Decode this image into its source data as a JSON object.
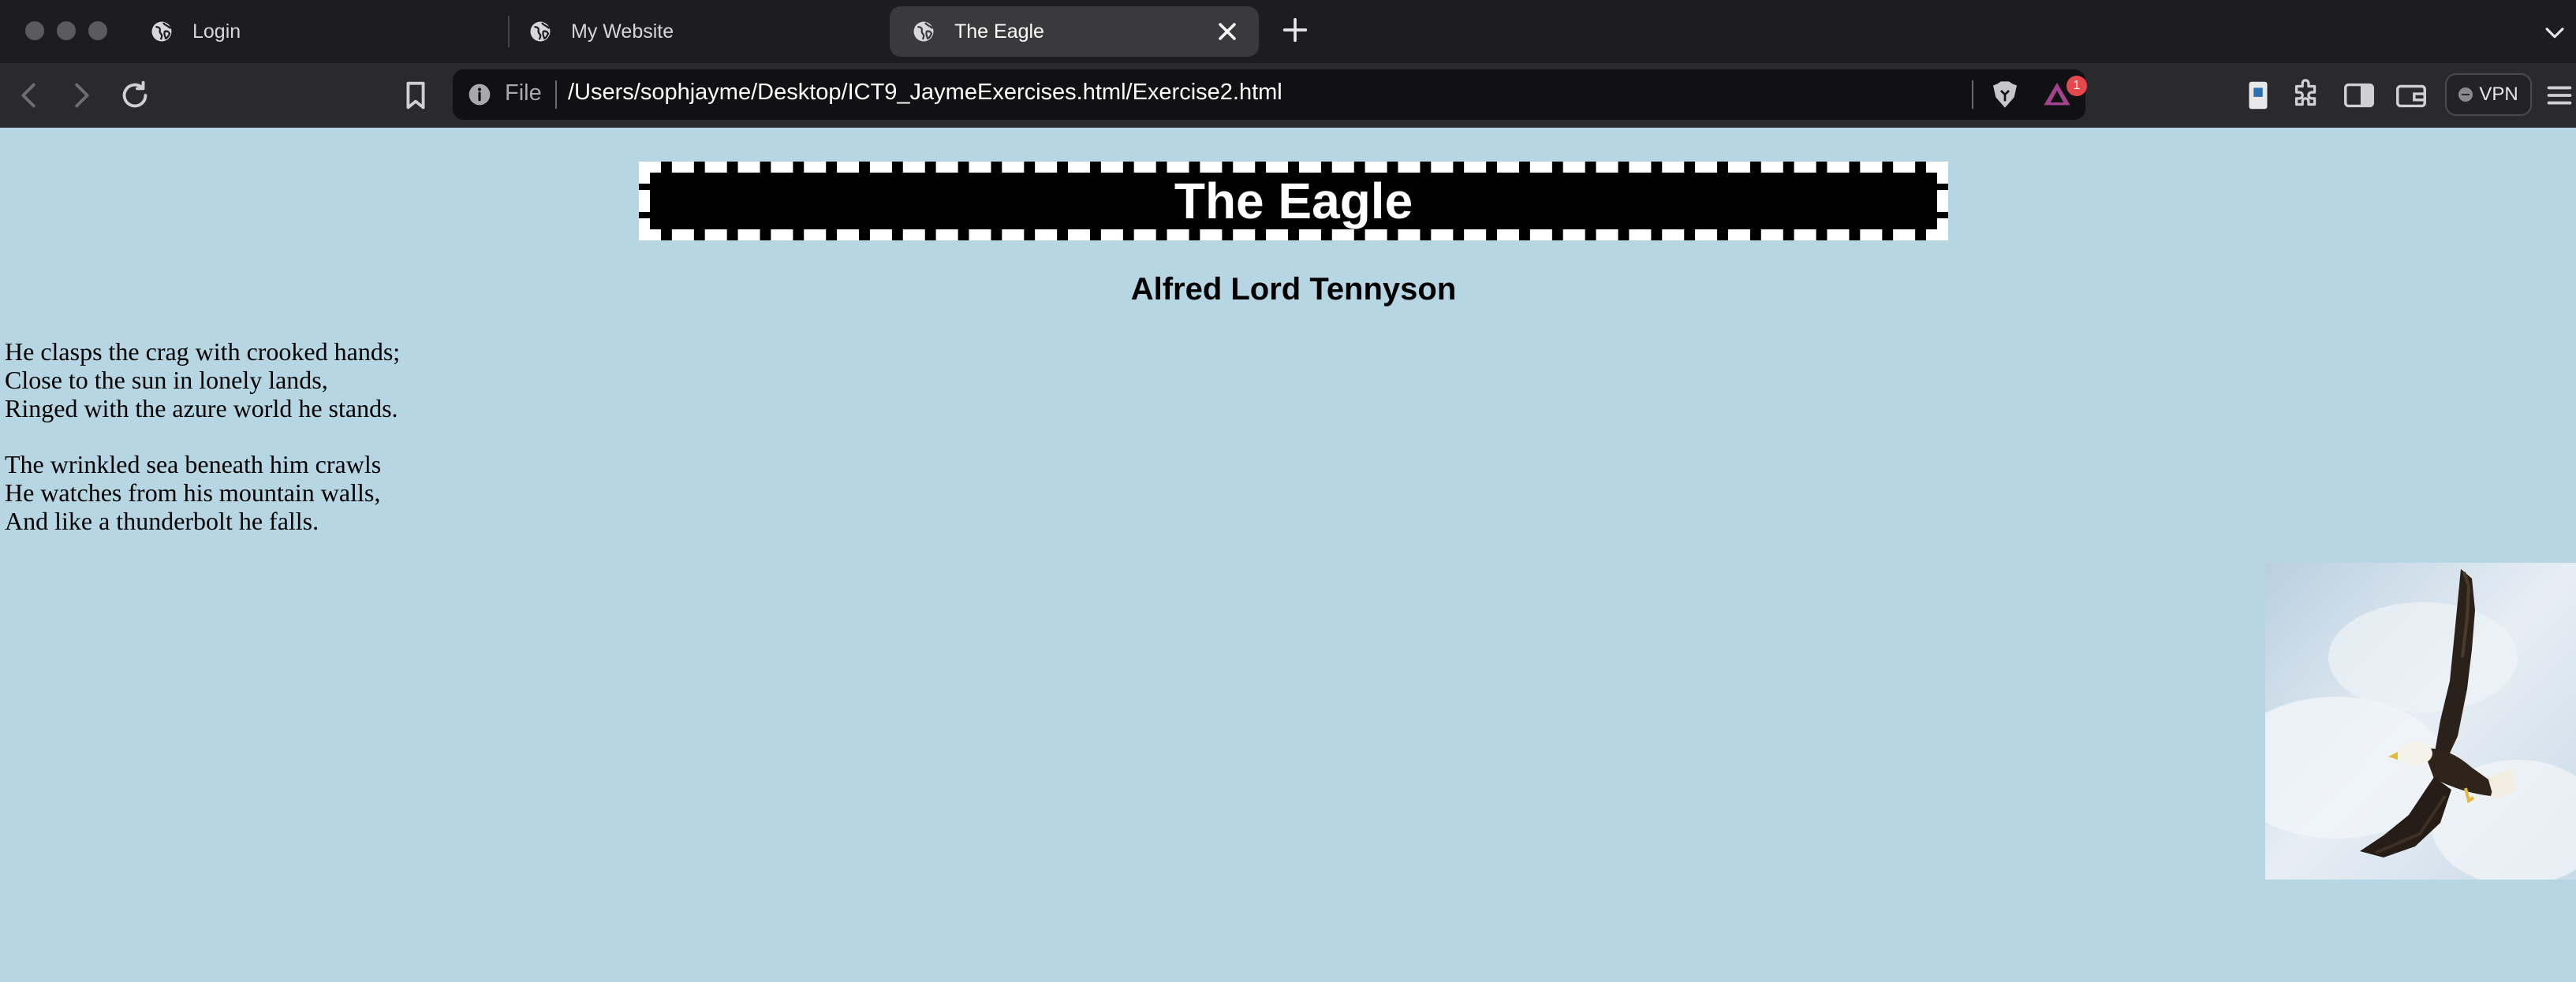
{
  "browser": {
    "tabs": [
      {
        "label": "Login"
      },
      {
        "label": "My Website"
      },
      {
        "label": "The Eagle",
        "active": true
      }
    ],
    "address": {
      "scheme_label": "File",
      "url": "/Users/sophjayme/Desktop/ICT9_JaymeExercises.html/Exercise2.html"
    },
    "rewards_badge": "1",
    "vpn_label": "VPN",
    "icons": [
      "back-icon",
      "forward-icon",
      "reload-icon",
      "bookmark-icon",
      "info-icon",
      "brave-shield-icon",
      "brave-rewards-icon",
      "extension-icon",
      "puzzle-icon",
      "sidebar-icon",
      "wallet-icon",
      "menu-icon",
      "close-icon",
      "plus-icon",
      "chevron-down-icon",
      "globe-icon"
    ]
  },
  "page": {
    "background": "#b6d6e3",
    "title": "The Eagle",
    "author": "Alfred Lord Tennyson",
    "stanzas": [
      [
        "He clasps the crag with crooked hands;",
        "Close to the sun in lonely lands,",
        "Ringed with the azure world he stands."
      ],
      [
        "The wrinkled sea beneath him crawls",
        "He watches from his mountain walls,",
        "And like a thunderbolt he falls."
      ]
    ],
    "image": {
      "subject": "bald eagle in flight against sky"
    }
  }
}
